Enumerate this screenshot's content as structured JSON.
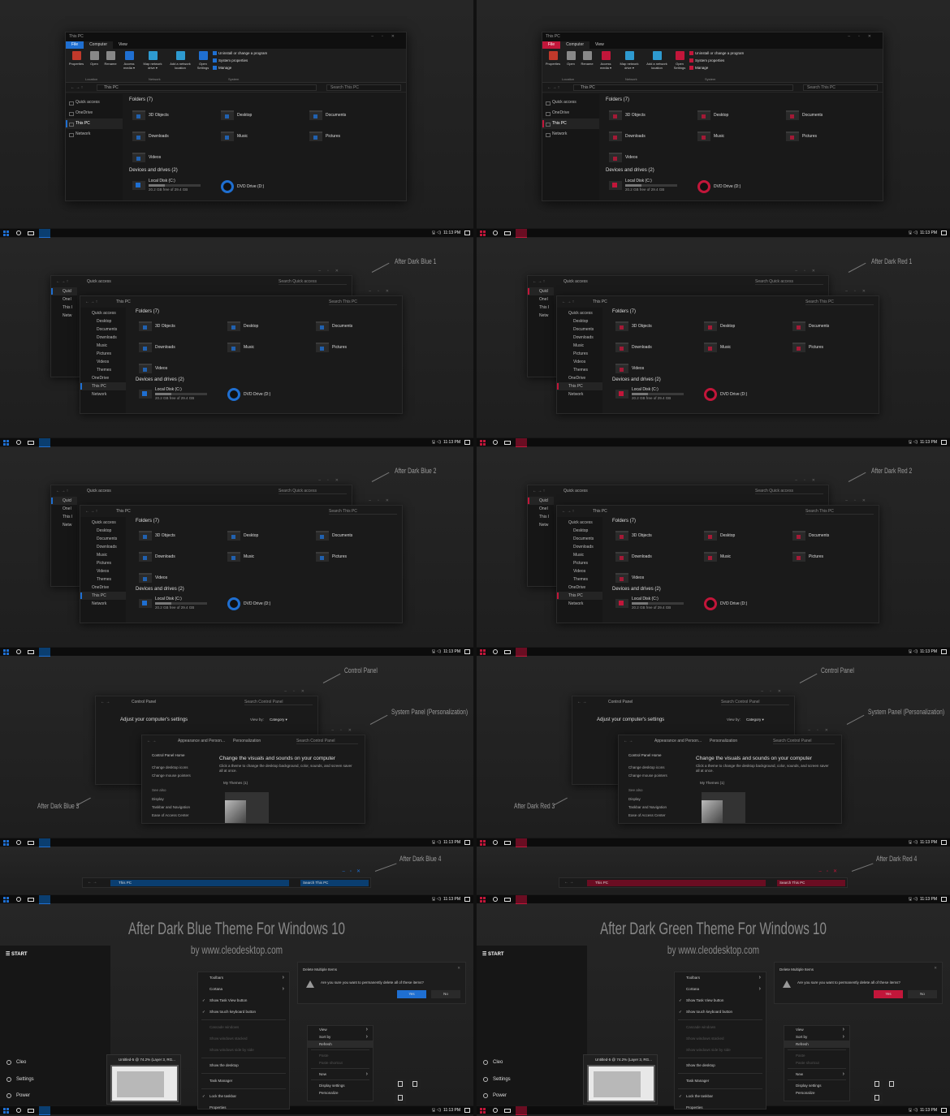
{
  "colors": {
    "blue": "#1f6fd1",
    "blue_dark": "#0a3e70",
    "red": "#c2163a",
    "red_dark": "#6a0d22"
  },
  "explorer": {
    "title": "This PC",
    "tab_file": "File",
    "tab_computer": "Computer",
    "tab_view": "View",
    "ribbon": {
      "properties": "Properties",
      "open": "Open",
      "rename": "Rename",
      "access_media": "Access media ▾",
      "map_drive": "Map network drive ▾",
      "add_location": "Add a network location",
      "open_settings": "Open Settings",
      "uninstall": "Uninstall or change a program",
      "system_props": "System properties",
      "manage": "Manage",
      "group_location": "Location",
      "group_network": "Network",
      "group_system": "System"
    },
    "address": "This PC",
    "search": "Search This PC",
    "nav": [
      "Quick access",
      "OneDrive",
      "This PC",
      "Network"
    ],
    "folders_header": "Folders (7)",
    "folders": [
      "3D Objects",
      "Desktop",
      "Documents",
      "Downloads",
      "Music",
      "Pictures",
      "Videos"
    ],
    "drives_header": "Devices and drives (2)",
    "disk_name": "Local Disk (C:)",
    "disk_free": "20.2 GB free of 29.4 GB",
    "disk_used_fraction": 0.31,
    "dvd_name": "DVD Drive (D:)"
  },
  "taskbar": {
    "tray": "🖫 ◁)",
    "time": "11:13 PM"
  },
  "quick": {
    "back_address": "Quick access",
    "back_search": "Search Quick access",
    "back_nav": [
      "Quicl",
      "OneI",
      "This I",
      "Netw"
    ],
    "nav": [
      "Quick access",
      "Desktop",
      "Documents",
      "Downloads",
      "Music",
      "Pictures",
      "Videos",
      "Themes",
      "OneDrive",
      "This PC",
      "Network"
    ]
  },
  "labels": {
    "blue1": "After Dark Blue 1",
    "red1": "After Dark Red 1",
    "blue2": "After Dark Blue 2",
    "red2": "After Dark Red 2",
    "control_panel": "Control Panel",
    "system_panel": "System Panel (Personalization)",
    "blue3": "After Dark Blue 3",
    "red3": "After Dark Red 3",
    "blue4": "After Dark Blue 4",
    "red4": "After Dark Red 4"
  },
  "control_panel": {
    "address": "Control Panel",
    "search": "Search Control Panel",
    "heading": "Adjust your computer's settings",
    "viewby": "View by:",
    "category": "Category ▾"
  },
  "personalization": {
    "address1": "Appearance and Person...",
    "address2": "Personalization",
    "search": "Search Control Panel",
    "home": "Control Panel Home",
    "links": [
      "Change desktop icons",
      "Change mouse pointers"
    ],
    "see_also": "See also",
    "see_links": [
      "Display",
      "Taskbar and Navigation",
      "Ease of Access Center"
    ],
    "heading": "Change the visuals and sounds on your computer",
    "desc": "Click a theme to change the desktop background, color, sounds, and screen saver all at once.",
    "my_themes": "My Themes (1)"
  },
  "wide": {
    "address": "This PC",
    "search": "Search This PC"
  },
  "promo": {
    "title_left": "After Dark Blue Theme For Windows 10",
    "title_right": "After Dark Green Theme For Windows 10",
    "subtitle": "by www.cleodesktop.com"
  },
  "start": {
    "header": "START",
    "user": "Cleo",
    "settings": "Settings",
    "power": "Power",
    "thumb_title": "Untitled-5 @ 74.2% (Layer 3, RG..."
  },
  "taskbar_menu": [
    {
      "label": "Toolbars",
      "arrow": true
    },
    {
      "label": "Cortana",
      "arrow": true
    },
    {
      "label": "Show Task View button",
      "check": true
    },
    {
      "label": "Show touch keyboard button",
      "check": true
    },
    {
      "label": "Cascade windows",
      "disabled": true
    },
    {
      "label": "Show windows stacked",
      "disabled": true
    },
    {
      "label": "Show windows side by side",
      "disabled": true
    },
    {
      "label": "Show the desktop"
    },
    {
      "label": "Task Manager"
    },
    {
      "label": "Lock the taskbar",
      "check": true
    },
    {
      "label": "Properties"
    }
  ],
  "desktop_menu": [
    {
      "label": "View",
      "arrow": true
    },
    {
      "label": "Sort by",
      "arrow": true
    },
    {
      "label": "Refresh",
      "hi": true
    },
    {
      "label": "Paste",
      "disabled": true
    },
    {
      "label": "Paste shortcut",
      "disabled": true
    },
    {
      "label": "New",
      "arrow": true
    },
    {
      "label": "Display settings"
    },
    {
      "label": "Personalize"
    }
  ],
  "dialog": {
    "title": "Delete Multiple Items",
    "question": "Are you sure you want to permanently delete all of these items?",
    "yes": "Yes",
    "no": "No"
  }
}
